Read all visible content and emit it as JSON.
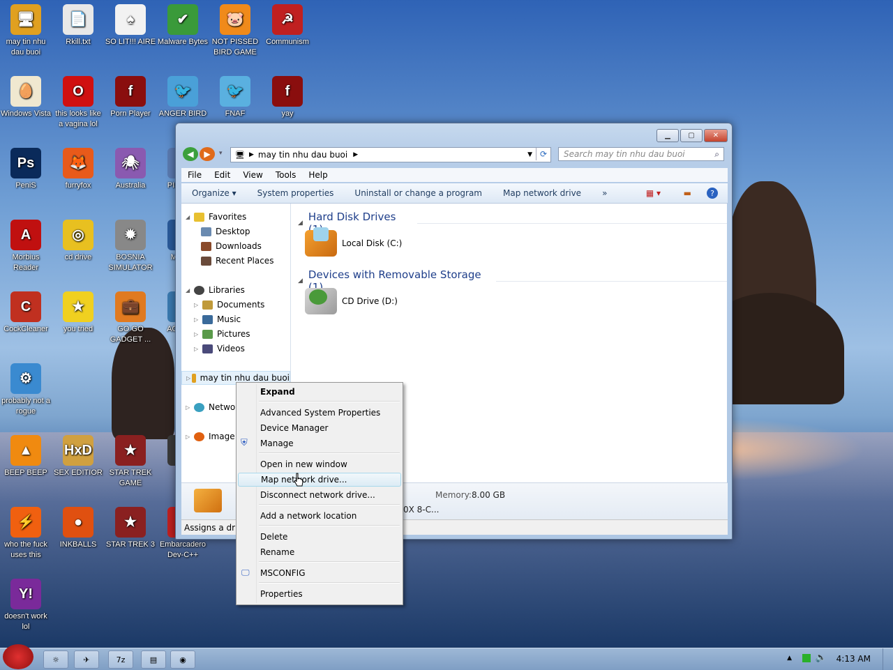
{
  "desktop": {
    "icons": [
      {
        "label": "may tin nhu dau buoi",
        "color": "#e0a020",
        "glyph": "🖥"
      },
      {
        "label": "Rkill.txt",
        "color": "#e8e8e8",
        "glyph": "📄"
      },
      {
        "label": "SO LIT!!! AIRE",
        "color": "#f2f2f2",
        "glyph": "♠"
      },
      {
        "label": "Malware Bytes",
        "color": "#3a9a3a",
        "glyph": "✔"
      },
      {
        "label": "NOT PISSED BIRD GAME",
        "color": "#f08a1a",
        "glyph": "🐷"
      },
      {
        "label": "Communism",
        "color": "#c02020",
        "glyph": "☭"
      },
      {
        "label": "Windows Vista",
        "color": "#f0e8d0",
        "glyph": "🥚"
      },
      {
        "label": "this looks like a vagina lol",
        "color": "#d01010",
        "glyph": "O"
      },
      {
        "label": "Porn Player",
        "color": "#8a0e0e",
        "glyph": "f"
      },
      {
        "label": "ANGER BIRD",
        "color": "#4aa0d8",
        "glyph": "🐦"
      },
      {
        "label": "FNAF",
        "color": "#5ab0e0",
        "glyph": "🐦"
      },
      {
        "label": "yay",
        "color": "#8a0e0e",
        "glyph": "f"
      },
      {
        "label": "PeniS",
        "color": "#0a2a5a",
        "glyph": "Ps"
      },
      {
        "label": "furryfox",
        "color": "#e85a1a",
        "glyph": "🦊"
      },
      {
        "label": "Australia",
        "color": "#8a5ab0",
        "glyph": "🕷"
      },
      {
        "label": "PIS AVIA",
        "color": "#5a7ab0",
        "glyph": "✈"
      },
      {
        "label": "Morbius Reader",
        "color": "#c01010",
        "glyph": "A"
      },
      {
        "label": "cd drive",
        "color": "#e8c020",
        "glyph": "◎"
      },
      {
        "label": "BOSNIA SIMULATOR",
        "color": "#888888",
        "glyph": "✹"
      },
      {
        "label": "MA UN",
        "color": "#2a5a9a",
        "glyph": "M"
      },
      {
        "label": "CockCleaner",
        "color": "#c03020",
        "glyph": "C"
      },
      {
        "label": "you tried",
        "color": "#f0d020",
        "glyph": "★"
      },
      {
        "label": "GO GO GADGET ...",
        "color": "#e07a20",
        "glyph": "💼"
      },
      {
        "label": "AGC CHI",
        "color": "#3a7ab0",
        "glyph": "A"
      },
      {
        "label": "probably not a rogue",
        "color": "#3a8ad0",
        "glyph": "⚙"
      },
      {
        "label": "BEEP BEEP",
        "color": "#f08a10",
        "glyph": "▲"
      },
      {
        "label": "SEX EDITIOR",
        "color": "#d0a040",
        "glyph": "HxD"
      },
      {
        "label": "STAR TREK GAME",
        "color": "#8a2020",
        "glyph": "★"
      },
      {
        "label": "MIN",
        "color": "#3a3a3a",
        "glyph": "M"
      },
      {
        "label": "who the fuck uses this",
        "color": "#f06010",
        "glyph": "⚡"
      },
      {
        "label": "INKBALLS",
        "color": "#e05010",
        "glyph": "●"
      },
      {
        "label": "STAR TREK 3",
        "color": "#8a2020",
        "glyph": "★"
      },
      {
        "label": "Embarcadero Dev-C++",
        "color": "#c02020",
        "glyph": "C"
      },
      {
        "label": "doesn't work lol",
        "color": "#7a2a9a",
        "glyph": "Y!"
      }
    ]
  },
  "window": {
    "address": "may tin nhu dau buoi",
    "search_placeholder": "Search may tin nhu dau buoi",
    "menu": [
      "File",
      "Edit",
      "View",
      "Tools",
      "Help"
    ],
    "commands": [
      "Organize ▾",
      "System properties",
      "Uninstall or change a program",
      "Map network drive",
      "»"
    ],
    "nav": {
      "favorites": "Favorites",
      "desktop": "Desktop",
      "downloads": "Downloads",
      "recent": "Recent Places",
      "libraries": "Libraries",
      "documents": "Documents",
      "music": "Music",
      "pictures": "Pictures",
      "videos": "Videos",
      "computer": "may tin nhu dau buoi",
      "network": "Networ",
      "image": "Image C"
    },
    "groups": {
      "hdd_title": "Hard Disk Drives (1)",
      "hdd_item": "Local Disk (C:)",
      "removable_title": "Devices with Removable Storage (1)",
      "removable_item": "CD Drive (D:)"
    },
    "details": {
      "memory_label": "Memory:",
      "memory_value": "8.00 GB",
      "cpu_fragment": "0X 8-C..."
    },
    "status": "Assigns a drive"
  },
  "context_menu": {
    "items": [
      {
        "label": "Expand",
        "bold": true
      },
      {
        "label": "Advanced System Properties"
      },
      {
        "label": "Device Manager"
      },
      {
        "label": "Manage",
        "icon": "shield-icon"
      },
      {
        "label": "Open in new window"
      },
      {
        "label": "Map network drive...",
        "highlighted": true
      },
      {
        "label": "Disconnect network drive..."
      },
      {
        "label": "Add a network location"
      },
      {
        "label": "Delete"
      },
      {
        "label": "Rename"
      },
      {
        "label": "MSCONFIG",
        "icon": "monitor-icon"
      },
      {
        "label": "Properties"
      }
    ]
  },
  "taskbar": {
    "clock": "4:13 AM"
  },
  "colors": {
    "accent": "#1e3e8a",
    "highlight_border": "#a8d8eb",
    "close_button": "#c4432d"
  }
}
